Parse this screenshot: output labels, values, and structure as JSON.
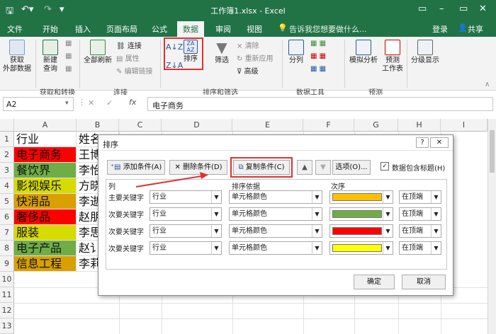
{
  "window": {
    "title": "工作簿1.xlsx - Excel"
  },
  "ribbon_tabs": [
    "文件",
    "开始",
    "插入",
    "页面布局",
    "公式",
    "数据",
    "审阅",
    "视图"
  ],
  "tell_me": "告诉我您想要做什么...",
  "account": {
    "login": "登录",
    "share": "共享"
  },
  "ribbon": {
    "get_external": "获取\n外部数据",
    "new_query": "新建\n查询",
    "refresh_all": "全部刷新",
    "connections": "连接",
    "properties": "属性",
    "edit_links": "编辑链接",
    "sort": "排序",
    "filter": "筛选",
    "clear": "清除",
    "reapply": "重新应用",
    "advanced": "高级",
    "text_to_columns": "分列",
    "what_if": "模拟分析",
    "forecast": "预测\n工作表",
    "outline": "分级显示",
    "groups": [
      "获取和转换",
      "连接",
      "排序和筛选",
      "数据工具",
      "预测"
    ]
  },
  "name_box": "A2",
  "formula": "电子商务",
  "columns": [
    "A",
    "B",
    "C",
    "D",
    "E",
    "F",
    "G",
    "H",
    "I"
  ],
  "rows": [
    "1",
    "2",
    "3",
    "4",
    "5",
    "6",
    "7",
    "8",
    "9",
    "10",
    "11",
    "12",
    "13"
  ],
  "sheet": {
    "header": [
      "行业",
      "姓名"
    ],
    "rows": [
      {
        "industry": "电子商务",
        "name": "王博",
        "color": "#ff0000"
      },
      {
        "industry": "餐饮界",
        "name": "李怡",
        "color": "#70ad47"
      },
      {
        "industry": "影视娱乐",
        "name": "方晓",
        "color": "#d6dc00"
      },
      {
        "industry": "快消品",
        "name": "李逝",
        "color": "#d9a000"
      },
      {
        "industry": "奢侈品",
        "name": "赵朋",
        "color": "#ff0000"
      },
      {
        "industry": "服装",
        "name": "李思",
        "color": "#d6dc00"
      },
      {
        "industry": "电子产品",
        "name": "赵讠",
        "color": "#70ad47"
      },
      {
        "industry": "信息工程",
        "name": "李莉",
        "color": "#d9a000"
      }
    ]
  },
  "dialog": {
    "title": "排序",
    "add_level": "添加条件(A)",
    "delete_level": "删除条件(D)",
    "copy_level": "复制条件(C)",
    "options": "选项(O)...",
    "has_headers": "数据包含标题(H)",
    "col_header": "列",
    "sort_on_header": "排序依据",
    "order_header": "次序",
    "levels": [
      {
        "label": "主要关键字",
        "column": "行业",
        "sort_on": "单元格颜色",
        "color": "#ffc000",
        "position": "在顶端"
      },
      {
        "label": "次要关键字",
        "column": "行业",
        "sort_on": "单元格颜色",
        "color": "#70ad47",
        "position": "在顶端"
      },
      {
        "label": "次要关键字",
        "column": "行业",
        "sort_on": "单元格颜色",
        "color": "#ff0000",
        "position": "在顶端"
      },
      {
        "label": "次要关键字",
        "column": "行业",
        "sort_on": "单元格颜色",
        "color": "#ffff00",
        "position": "在顶端"
      }
    ],
    "ok": "确定",
    "cancel": "取消"
  }
}
